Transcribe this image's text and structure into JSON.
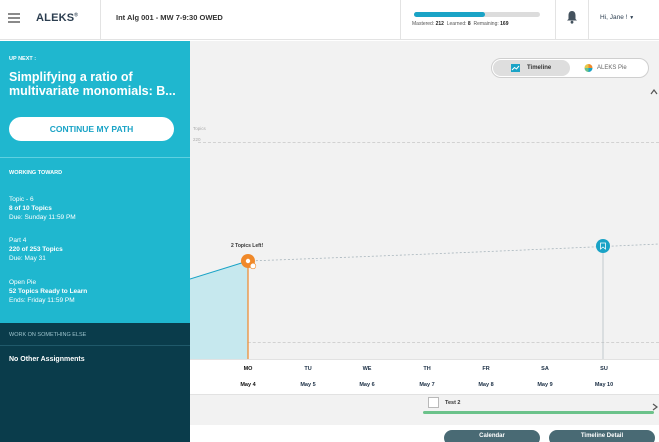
{
  "header": {
    "logo": "ALEKS",
    "logo_mark": "®",
    "class_name": "Int Alg 001 - MW 7-9:30 OWED",
    "progress": {
      "mastered_label": "Mastered:",
      "mastered": "212",
      "learned_label": "Learned:",
      "learned": "8",
      "remaining_label": "Remaining:",
      "remaining": "169",
      "fill_fraction": 0.56
    },
    "user_greeting": "Hi, Jane !"
  },
  "sidebar": {
    "up_next_label": "UP NEXT :",
    "up_next_title": "Simplifying a ratio of multivariate monomials: B...",
    "continue_button": "CONTINUE MY PATH",
    "working_toward_label": "WORKING TOWARD",
    "topic": {
      "title": "Topic - 6",
      "progress": "8 of 10 Topics",
      "due": "Due: Sunday 11:59 PM"
    },
    "part": {
      "title": "Part 4",
      "progress": "220 of 253 Topics",
      "due": "Due: May 31"
    },
    "pie": {
      "title": "Open Pie",
      "progress": "52 Topics Ready to Learn",
      "due": "Ends: Friday 11:59 PM"
    },
    "work_else_label": "WORK ON SOMETHING ELSE",
    "no_other": "No Other Assignments"
  },
  "view_toggle": {
    "timeline": "Timeline",
    "pie": "ALEKS Pie",
    "active": "timeline"
  },
  "timeline": {
    "y_axis_label": "Topics",
    "y_tick_top": "220",
    "y_tick_bottom": "210",
    "note": "2 Topics Left!",
    "days": [
      {
        "name": "MO",
        "date": "May 4"
      },
      {
        "name": "TU",
        "date": "May 5"
      },
      {
        "name": "WE",
        "date": "May 6"
      },
      {
        "name": "TH",
        "date": "May 7"
      },
      {
        "name": "FR",
        "date": "May 8"
      },
      {
        "name": "SA",
        "date": "May 9"
      },
      {
        "name": "SU",
        "date": "May 10"
      }
    ],
    "test_label": "Test 2",
    "colors": {
      "current": "#f0892a",
      "goal": "#1aa3c6",
      "test": "#6bc28a"
    }
  },
  "footer": {
    "calendar_button": "Calendar",
    "timeline_detail_button": "Timeline Detail"
  }
}
